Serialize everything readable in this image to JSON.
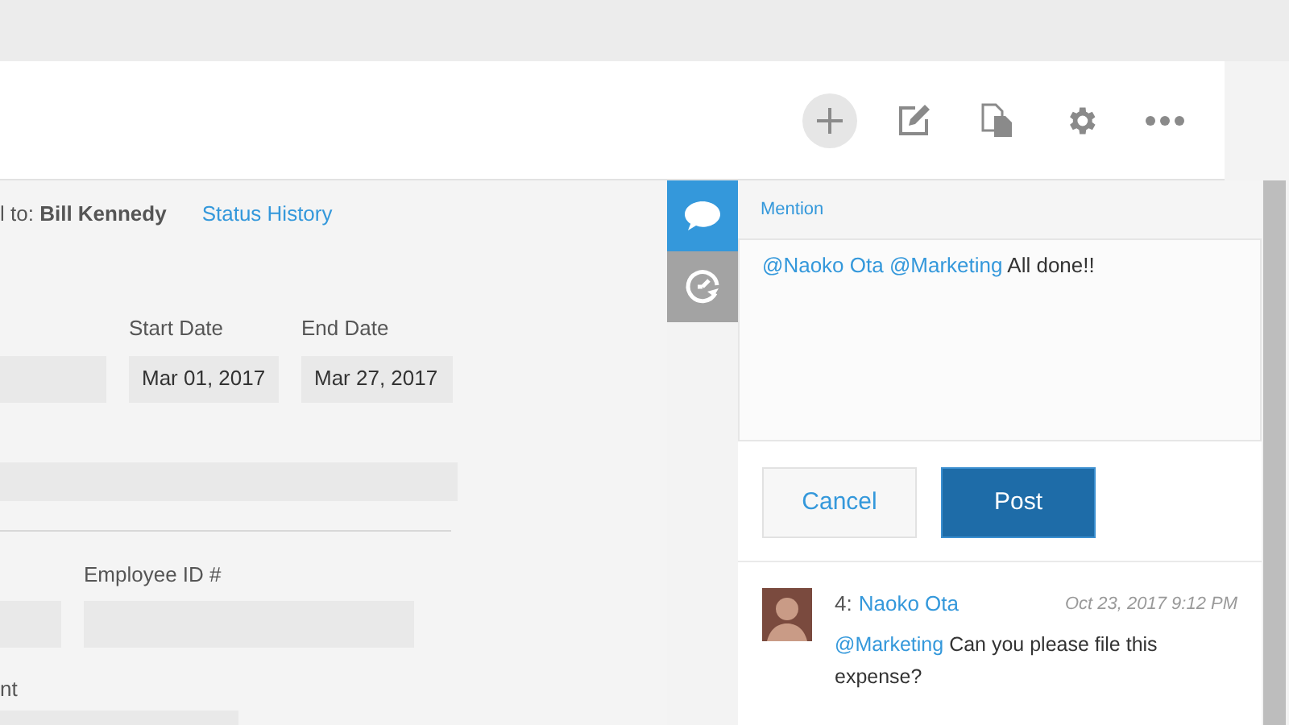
{
  "toolbar": [
    {
      "kind": "add",
      "highlighted": true
    },
    {
      "kind": "edit",
      "highlighted": false
    },
    {
      "kind": "copy",
      "highlighted": false
    },
    {
      "kind": "settings",
      "highlighted": false
    },
    {
      "kind": "more",
      "highlighted": false
    }
  ],
  "record": {
    "assignee": "l to: **Bill Kennedy**",
    "status_link": "Status History"
  },
  "form": {
    "start_date": {
      "label": "Start Date",
      "value": "Mar 01, 2017"
    },
    "end_date": {
      "label": "End Date",
      "value": "Mar 27, 2017"
    },
    "employee_id": {
      "label": "Employee ID #"
    },
    "label_cut": "nt"
  },
  "side_tabs": [
    {
      "kind": "comments",
      "selected": true
    },
    {
      "kind": "history",
      "selected": false
    }
  ],
  "comment_box": {
    "mention_link": "Mention",
    "segments": [
      {
        "kind": "mention",
        "text": "@Naoko Ota"
      },
      {
        "kind": "mention",
        "text": "@Marketing"
      },
      {
        "kind": "text",
        "text": "All done!!"
      }
    ],
    "buttons": [
      {
        "kind": "secondary",
        "label": "Cancel"
      },
      {
        "kind": "primary",
        "label": "Post"
      }
    ]
  },
  "comments": [
    {
      "number": "4:",
      "author": "Naoko Ota",
      "time": "Oct 23, 2017 9:12 PM",
      "segments": [
        {
          "kind": "mention",
          "text": "@Marketing"
        },
        {
          "kind": "text",
          "text": "Can you please file this expense?"
        }
      ]
    }
  ]
}
